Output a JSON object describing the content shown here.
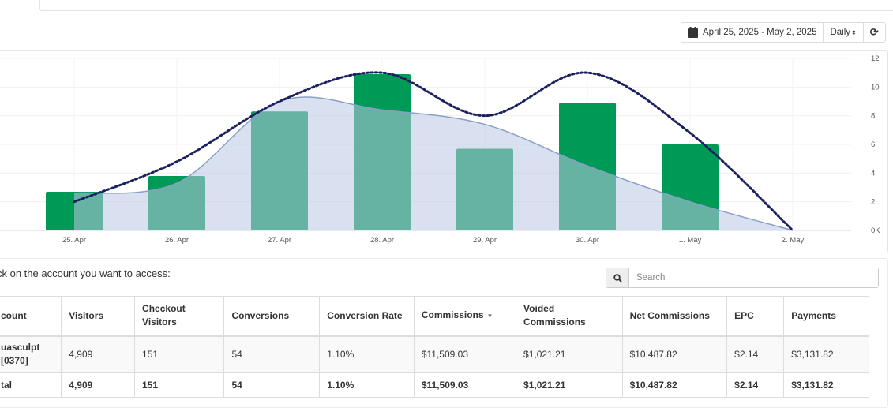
{
  "toolbar": {
    "date_range": "April 25, 2025 - May 2, 2025",
    "interval": "Daily",
    "icons": [
      "calendar-icon",
      "sort-arrows-icon",
      "refresh-icon"
    ]
  },
  "chart_data": {
    "type": "bar",
    "categories": [
      "25. Apr",
      "26. Apr",
      "27. Apr",
      "28. Apr",
      "29. Apr",
      "30. Apr",
      "1. May",
      "2. May"
    ],
    "series": [
      {
        "type": "bar",
        "color": "#009a57",
        "values": [
          2.7,
          3.8,
          8.3,
          10.9,
          5.7,
          8.9,
          6.0,
          0
        ]
      },
      {
        "type": "area",
        "color": "#b9c8e4",
        "values": [
          2.6,
          3.3,
          9.0,
          8.4,
          7.4,
          4.5,
          2.0,
          0
        ]
      },
      {
        "type": "line",
        "style": "dotted",
        "color": "#1a1f5e",
        "values": [
          2.0,
          4.8,
          9.0,
          11.0,
          8.0,
          11.0,
          6.8,
          0
        ]
      }
    ],
    "y_ticks": [
      "0K",
      "2",
      "4",
      "6",
      "8",
      "10",
      "12"
    ],
    "ylim": [
      0,
      12
    ],
    "grid": true
  },
  "prompt": "ck on the account you want to access:",
  "search": {
    "placeholder": "Search"
  },
  "table": {
    "headers": [
      "count",
      "Visitors",
      "Checkout Visitors",
      "Conversions",
      "Conversion Rate",
      "Commissions",
      "Voided Commissions",
      "Net Commissions",
      "EPC",
      "Payments"
    ],
    "sorted_column": "Commissions",
    "rows": [
      [
        "uasculpt [0370]",
        "4,909",
        "151",
        "54",
        "1.10%",
        "$11,509.03",
        "$1,021.21",
        "$10,487.82",
        "$2.14",
        "$3,131.82"
      ]
    ],
    "total": [
      "tal",
      "4,909",
      "151",
      "54",
      "1.10%",
      "$11,509.03",
      "$1,021.21",
      "$10,487.82",
      "$2.14",
      "$3,131.82"
    ]
  }
}
